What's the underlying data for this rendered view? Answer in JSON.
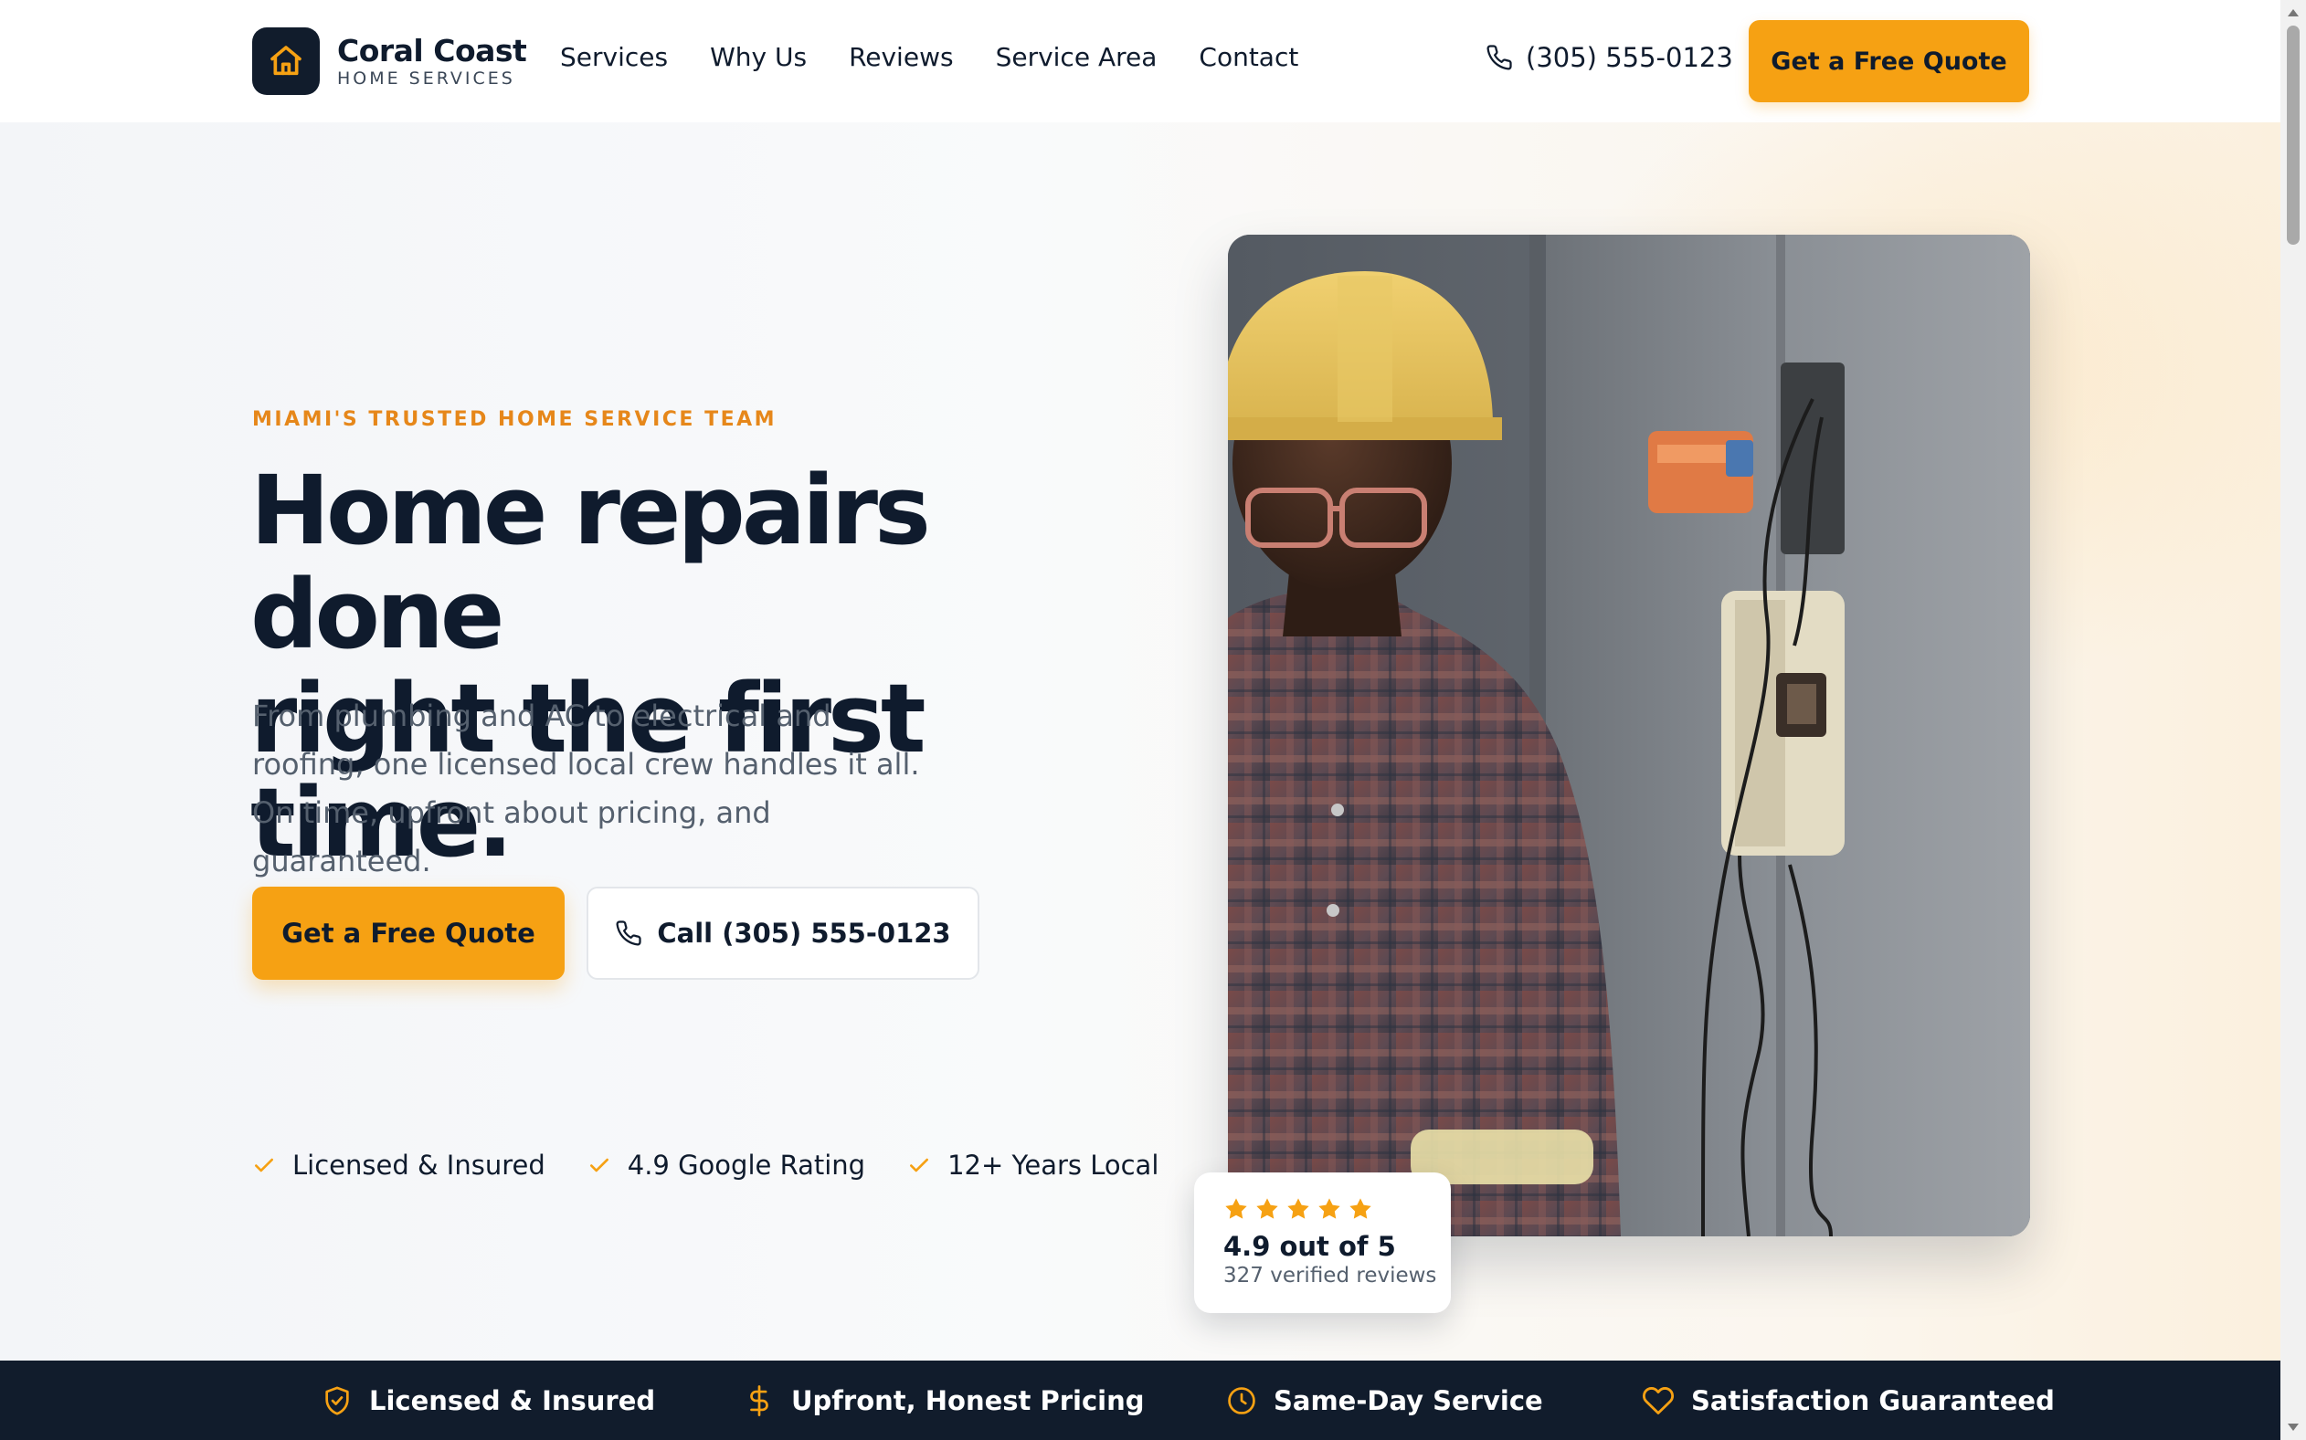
{
  "brand": {
    "name": "Coral Coast",
    "tagline": "HOME SERVICES"
  },
  "nav": {
    "items": [
      "Services",
      "Why Us",
      "Reviews",
      "Service Area",
      "Contact"
    ]
  },
  "header": {
    "phone": "(305) 555-0123",
    "cta_label": "Get a Free Quote"
  },
  "hero": {
    "eyebrow": "MIAMI'S TRUSTED HOME SERVICE TEAM",
    "headline_line1": "Home repairs done",
    "headline_line2": "right the first time.",
    "subcopy": "From plumbing and AC to electrical and roofing, one licensed local crew handles it all. On time, upfront about pricing, and guaranteed.",
    "primary_cta": "Get a Free Quote",
    "secondary_cta": "Call (305) 555-0123",
    "trust_items": [
      "Licensed & Insured",
      "4.9 Google Rating",
      "12+ Years Local"
    ]
  },
  "rating_card": {
    "stars": 5,
    "score_text": "4.9 out of 5",
    "reviews_text": "327 verified reviews"
  },
  "features": [
    {
      "label": "Licensed & Insured",
      "icon": "shield-check-icon"
    },
    {
      "label": "Upfront, Honest Pricing",
      "icon": "dollar-icon"
    },
    {
      "label": "Same-Day Service",
      "icon": "clock-icon"
    },
    {
      "label": "Satisfaction Guaranteed",
      "icon": "heart-icon"
    }
  ],
  "colors": {
    "accent": "#f6a113",
    "eyebrow": "#e6871a",
    "navy": "#111c2c",
    "text": "#0f1b2d",
    "muted": "#55606e"
  }
}
